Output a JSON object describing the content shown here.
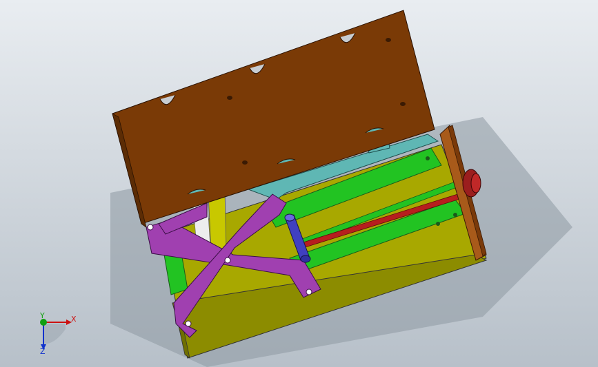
{
  "viewport": {
    "background_top": "#e9edf1",
    "background_bottom": "#b7c0c9"
  },
  "triad": {
    "x_label": "X",
    "y_label": "Y",
    "z_label": "Z",
    "x_color": "#cc1111",
    "y_color": "#11a011",
    "z_color": "#1133cc"
  },
  "model": {
    "top_plate_color": "#7a3a06",
    "base_color": "#a8a800",
    "rail_color": "#22c322",
    "linkage_color": "#a040b0",
    "bracket_color": "#5fb7b4",
    "endplate_color": "#a85a1a",
    "rod_color": "#b71e1e",
    "knob_color": "#9b1e1e",
    "roller_color": "#4040c0",
    "post_color": "#c8c800"
  }
}
